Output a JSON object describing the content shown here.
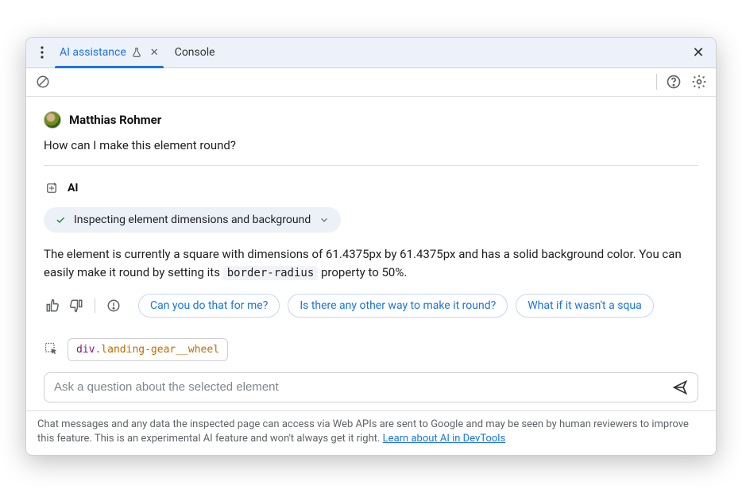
{
  "tabs": {
    "active": "AI assistance",
    "inactive": "Console"
  },
  "user": {
    "name": "Matthias Rohmer",
    "message": "How can I make this element round?"
  },
  "ai": {
    "label": "AI",
    "status": "Inspecting element dimensions and background",
    "response_pre": "The element is currently a square with dimensions of 61.4375px by 61.4375px and has a solid background color. You can easily make it round by setting its ",
    "response_code": "border-radius",
    "response_post": " property to 50%."
  },
  "suggestions": [
    "Can you do that for me?",
    "Is there any other way to make it round?",
    "What if it wasn't a squa"
  ],
  "element": {
    "tag": "div",
    "cls": ".landing-gear__wheel"
  },
  "input": {
    "placeholder": "Ask a question about the selected element"
  },
  "disclaimer": {
    "text": "Chat messages and any data the inspected page can access via Web APIs are sent to Google and may be seen by human reviewers to improve this feature. This is an experimental AI feature and won't always get it right. ",
    "link": "Learn about AI in DevTools"
  }
}
